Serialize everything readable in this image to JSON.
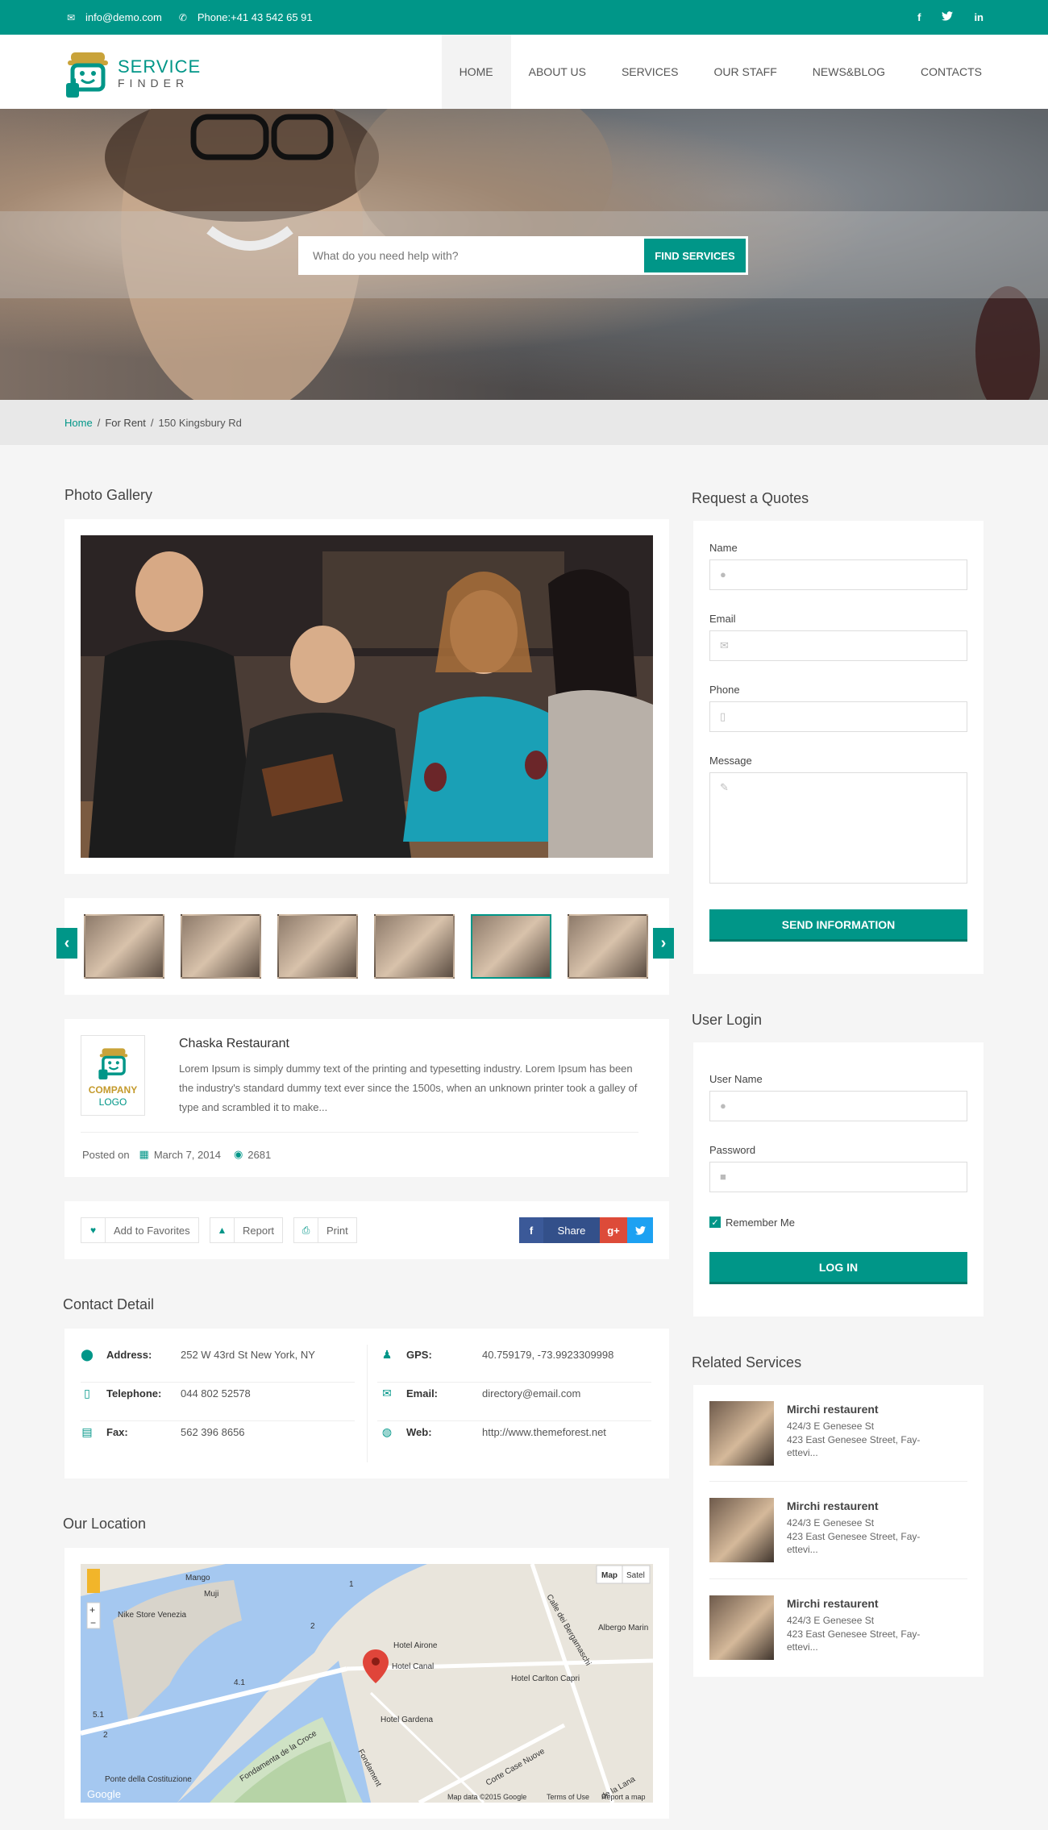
{
  "topbar": {
    "email": "info@demo.com",
    "phone": "Phone:+41 43 542 65 91",
    "social": [
      "f",
      "t",
      "in"
    ]
  },
  "logo": {
    "line1": "SERVICE",
    "line2": "FINDER"
  },
  "nav": [
    "HOME",
    "ABOUT US",
    "SERVICES",
    "OUR STAFF",
    "NEWS&BLOG",
    "CONTACTS"
  ],
  "hero": {
    "search_placeholder": "What do you need help with?",
    "search_button": "FIND SERVICES"
  },
  "breadcrumb": {
    "home": "Home",
    "section": "For Rent",
    "current": "150 Kingsbury Rd"
  },
  "gallery": {
    "title": "Photo Gallery",
    "thumb_count": 6,
    "active_thumb": 5
  },
  "listing": {
    "logo_line1": "COMPANY",
    "logo_line2": "LOGO",
    "title": "Chaska Restaurant",
    "description": "Lorem Ipsum is simply dummy text of the printing and typesetting industry. Lorem Ipsum has been the industry's standard dummy text ever since the 1500s, when an unknown printer took a galley of type and scrambled it to make...",
    "posted_on": "Posted on",
    "date": "March 7, 2014",
    "views": "2681"
  },
  "actions": {
    "favorites": "Add to Favorites",
    "report": "Report",
    "print": "Print",
    "share": "Share"
  },
  "contact": {
    "title": "Contact Detail",
    "address_label": "Address:",
    "address": "252 W 43rd St New York, NY",
    "gps_label": "GPS:",
    "gps": "40.759179, -73.9923309998",
    "telephone_label": "Telephone:",
    "telephone": "044 802 52578",
    "email_label": "Email:",
    "email": "directory@email.com",
    "fax_label": "Fax:",
    "fax": "562 396 8656",
    "web_label": "Web:",
    "web": "http://www.themeforest.net"
  },
  "location": {
    "title": "Our Location",
    "map_btn": "Map",
    "sat_btn": "Satel",
    "labels": {
      "mango": "Mango",
      "muji": "Muji",
      "nike": "Nike Store Venezia",
      "airone": "Hotel Airone",
      "canal": "Hotel Canal",
      "capri": "Hotel Carlton Capri",
      "gardena": "Hotel Gardena",
      "albergo": "Albergo Marin",
      "ponte": "Ponte della Costituzione",
      "fondamenta": "Fondamenta de la Croce",
      "fondamenta2": "Fondament",
      "corte": "Corte Case Nuove",
      "calle": "Calle dei Bergamaschi",
      "lana": "de la Lana",
      "n1": "1",
      "n2": "2",
      "n41": "4.1",
      "n51": "5.1",
      "n2b": "2",
      "attr1": "Map data ©2015 Google",
      "attr2": "Terms of Use",
      "attr3": "Report a map",
      "google": "Google"
    }
  },
  "quote": {
    "title": "Request a Quotes",
    "name": "Name",
    "email": "Email",
    "phone": "Phone",
    "message": "Message",
    "button": "SEND INFORMATION"
  },
  "login": {
    "title": "User Login",
    "username": "User Name",
    "password": "Password",
    "remember": "Remember Me",
    "button": "LOG IN"
  },
  "related": {
    "title": "Related Services",
    "items": [
      {
        "title": "Mirchi restaurent",
        "addr1": "424/3 E Genesee St",
        "addr2": "423 East Genesee Street, Fay-ettevi..."
      },
      {
        "title": "Mirchi restaurent",
        "addr1": "424/3 E Genesee St",
        "addr2": "423 East Genesee Street, Fay-ettevi..."
      },
      {
        "title": "Mirchi restaurent",
        "addr1": "424/3 E Genesee St",
        "addr2": "423 East Genesee Street, Fay-ettevi..."
      }
    ]
  },
  "colors": {
    "accent": "#009688",
    "accent_dark": "#00796b",
    "background": "#f5f5f5"
  }
}
